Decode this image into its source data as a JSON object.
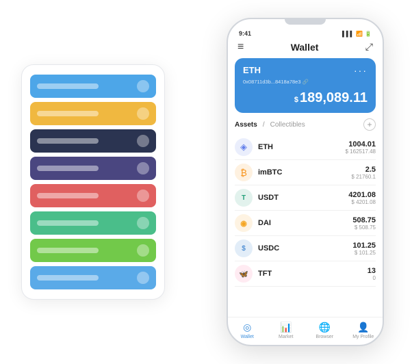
{
  "scene": {
    "card_stack": {
      "cards": [
        {
          "color": "card-blue",
          "label": "card-1"
        },
        {
          "color": "card-yellow",
          "label": "card-2"
        },
        {
          "color": "card-dark",
          "label": "card-3"
        },
        {
          "color": "card-purple",
          "label": "card-4"
        },
        {
          "color": "card-red",
          "label": "card-5"
        },
        {
          "color": "card-green",
          "label": "card-6"
        },
        {
          "color": "card-lightgreen",
          "label": "card-7"
        },
        {
          "color": "card-skyblue",
          "label": "card-8"
        }
      ]
    },
    "phone": {
      "status_bar": {
        "time": "9:41",
        "signal": "▌▌▌",
        "wifi": "WiFi",
        "battery": "⬛"
      },
      "header": {
        "menu_icon": "≡",
        "title": "Wallet",
        "expand_icon": "⤢"
      },
      "eth_card": {
        "name": "ETH",
        "address": "0x08711d3b...8418a78e3 🔗",
        "dots": "···",
        "balance_symbol": "$",
        "balance": "189,089.11"
      },
      "assets": {
        "tab_active": "Assets",
        "tab_slash": "/",
        "tab_inactive": "Collectibles",
        "add_icon": "+"
      },
      "asset_list": [
        {
          "icon": "◈",
          "icon_class": "asset-icon-eth",
          "name": "ETH",
          "amount": "1004.01",
          "usd": "$ 162517.48"
        },
        {
          "icon": "₿",
          "icon_class": "asset-icon-imbtc",
          "name": "imBTC",
          "amount": "2.5",
          "usd": "$ 21760.1"
        },
        {
          "icon": "T",
          "icon_class": "asset-icon-usdt",
          "name": "USDT",
          "amount": "4201.08",
          "usd": "$ 4201.08"
        },
        {
          "icon": "◈",
          "icon_class": "asset-icon-dai",
          "name": "DAI",
          "amount": "508.75",
          "usd": "$ 508.75"
        },
        {
          "icon": "$",
          "icon_class": "asset-icon-usdc",
          "name": "USDC",
          "amount": "101.25",
          "usd": "$ 101.25"
        },
        {
          "icon": "🦋",
          "icon_class": "asset-icon-tft",
          "name": "TFT",
          "amount": "13",
          "usd": "0"
        }
      ],
      "nav": [
        {
          "icon": "◎",
          "label": "Wallet",
          "active": true
        },
        {
          "icon": "📈",
          "label": "Market",
          "active": false
        },
        {
          "icon": "🌐",
          "label": "Browser",
          "active": false
        },
        {
          "icon": "👤",
          "label": "My Profile",
          "active": false
        }
      ]
    }
  }
}
